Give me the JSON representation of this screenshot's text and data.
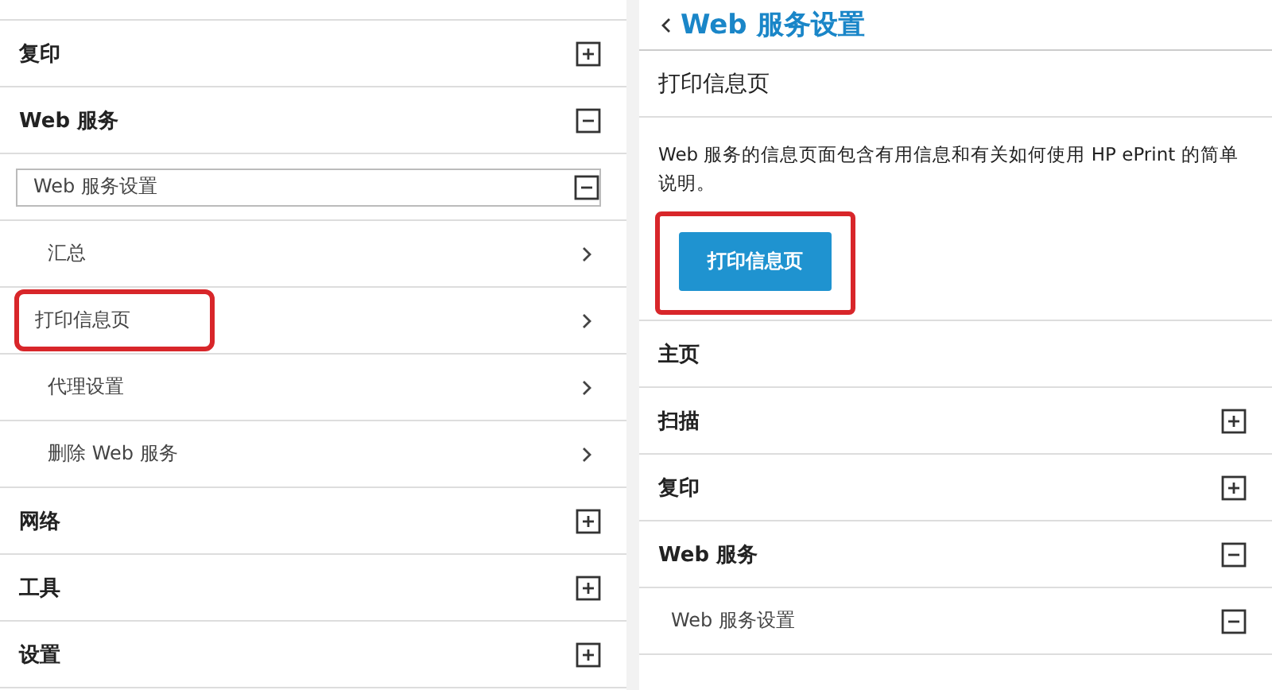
{
  "left_panel": {
    "items": [
      {
        "kind": "section",
        "label": "复印",
        "expanded": false
      },
      {
        "kind": "section",
        "label": "Web 服务",
        "expanded": true
      },
      {
        "kind": "group",
        "label": "Web 服务设置",
        "expanded": true
      },
      {
        "kind": "link",
        "label": "汇总",
        "highlighted": false
      },
      {
        "kind": "link",
        "label": "打印信息页",
        "highlighted": true
      },
      {
        "kind": "link",
        "label": "代理设置",
        "highlighted": false
      },
      {
        "kind": "link",
        "label": "删除 Web 服务",
        "highlighted": false
      },
      {
        "kind": "section",
        "label": "网络",
        "expanded": false
      },
      {
        "kind": "section",
        "label": "工具",
        "expanded": false
      },
      {
        "kind": "section",
        "label": "设置",
        "expanded": false
      }
    ]
  },
  "right_panel": {
    "back_title": "Web 服务设置",
    "page_title": "打印信息页",
    "description": "Web 服务的信息页面包含有用信息和有关如何使用 HP ePrint 的简单说明。",
    "button": {
      "label": "打印信息页",
      "highlighted": true
    },
    "items": [
      {
        "kind": "page",
        "label": "主页"
      },
      {
        "kind": "section",
        "label": "扫描",
        "expanded": false
      },
      {
        "kind": "section",
        "label": "复印",
        "expanded": false
      },
      {
        "kind": "section",
        "label": "Web 服务",
        "expanded": true
      },
      {
        "kind": "subsection",
        "label": "Web 服务设置",
        "expanded": true
      }
    ]
  }
}
